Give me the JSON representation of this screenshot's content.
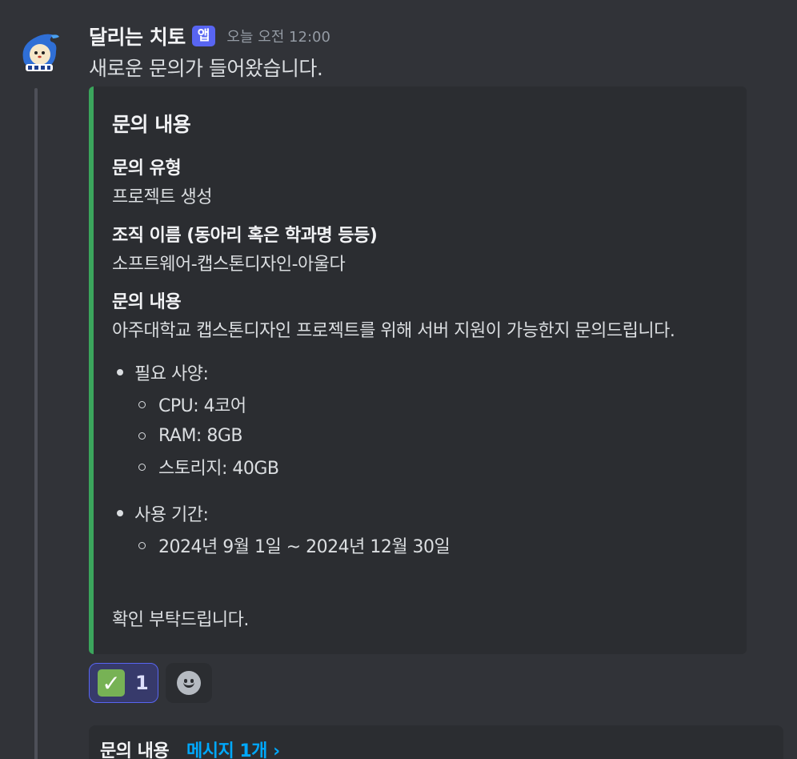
{
  "message": {
    "author": "달리는 치토",
    "app_badge": "앱",
    "timestamp": "오늘 오전 12:00",
    "text": "새로운 문의가 들어왔습니다."
  },
  "embed": {
    "accent_color": "#3ba55c",
    "title": "문의 내용",
    "fields": [
      {
        "name": "문의 유형",
        "value": "프로젝트 생성"
      },
      {
        "name": "조직 이름 (동아리 혹은 학과명 등등)",
        "value": "소프트웨어-캡스톤디자인-아울다"
      },
      {
        "name": "문의 내용",
        "value": "아주대학교 캡스톤디자인 프로젝트를 위해 서버 지원이 가능한지 문의드립니다."
      }
    ],
    "bullets": [
      {
        "label": "필요 사양:",
        "items": [
          "CPU: 4코어",
          "RAM: 8GB",
          "스토리지: 40GB"
        ]
      },
      {
        "label": "사용 기간:",
        "items": [
          "2024년 9월 1일 ~ 2024년 12월 30일"
        ]
      }
    ],
    "closing": "확인 부탁드립니다."
  },
  "reactions": [
    {
      "emoji": "white-check-mark",
      "glyph": "✓",
      "count": "1"
    },
    {
      "emoji": "add-reaction"
    }
  ],
  "thread": {
    "name": "문의 내용",
    "link": "메시지 1개 ›"
  }
}
